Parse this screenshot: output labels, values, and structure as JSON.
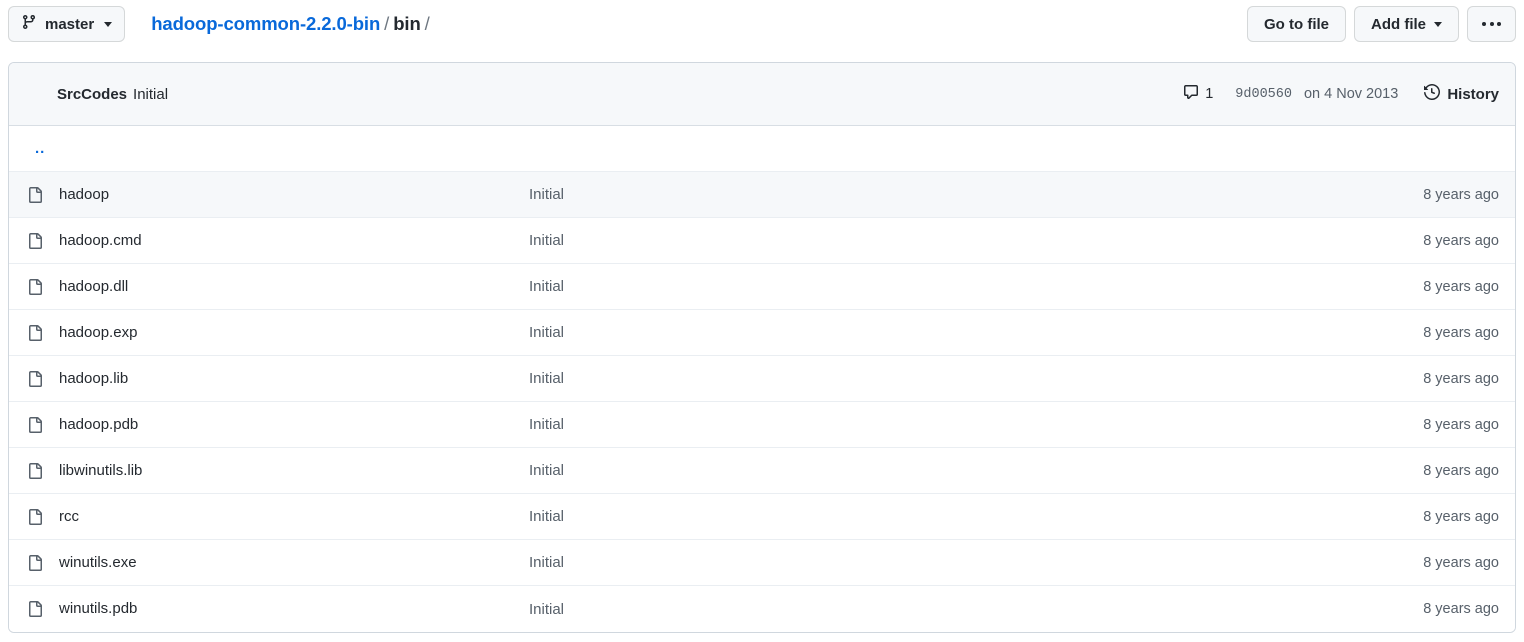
{
  "topbar": {
    "branch_icon": "git-branch-icon",
    "branch_name": "master",
    "breadcrumb": {
      "repo": "hadoop-common-2.2.0-bin",
      "sep1": "/",
      "current": "bin",
      "sep2": "/"
    },
    "go_to_file_label": "Go to file",
    "add_file_label": "Add file",
    "kebab_label": "..."
  },
  "commit_header": {
    "author": "SrcCodes",
    "message": "Initial",
    "comment_icon": "comment-icon",
    "comment_count": "1",
    "sha": "9d00560",
    "date": "on 4 Nov 2013",
    "history_icon": "history-clock-icon",
    "history_label": "History"
  },
  "parent_dir": {
    "label": "..",
    "icon": "parent-directory-link"
  },
  "file_rows": [
    {
      "icon": "file-icon",
      "name": "hadoop",
      "message": "Initial",
      "age": "8 years ago"
    },
    {
      "icon": "file-icon",
      "name": "hadoop.cmd",
      "message": "Initial",
      "age": "8 years ago"
    },
    {
      "icon": "file-icon",
      "name": "hadoop.dll",
      "message": "Initial",
      "age": "8 years ago"
    },
    {
      "icon": "file-icon",
      "name": "hadoop.exp",
      "message": "Initial",
      "age": "8 years ago"
    },
    {
      "icon": "file-icon",
      "name": "hadoop.lib",
      "message": "Initial",
      "age": "8 years ago"
    },
    {
      "icon": "file-icon",
      "name": "hadoop.pdb",
      "message": "Initial",
      "age": "8 years ago"
    },
    {
      "icon": "file-icon",
      "name": "libwinutils.lib",
      "message": "Initial",
      "age": "8 years ago"
    },
    {
      "icon": "file-icon",
      "name": "rcc",
      "message": "Initial",
      "age": "8 years ago"
    },
    {
      "icon": "file-icon",
      "name": "winutils.exe",
      "message": "Initial",
      "age": "8 years ago"
    },
    {
      "icon": "file-icon",
      "name": "winutils.pdb",
      "message": "Initial",
      "age": "8 years ago"
    }
  ],
  "colors": {
    "link": "#0969da",
    "text": "#24292f",
    "muted": "#57606a",
    "border": "#d0d7de",
    "row_shade": "#f6f8fa"
  }
}
